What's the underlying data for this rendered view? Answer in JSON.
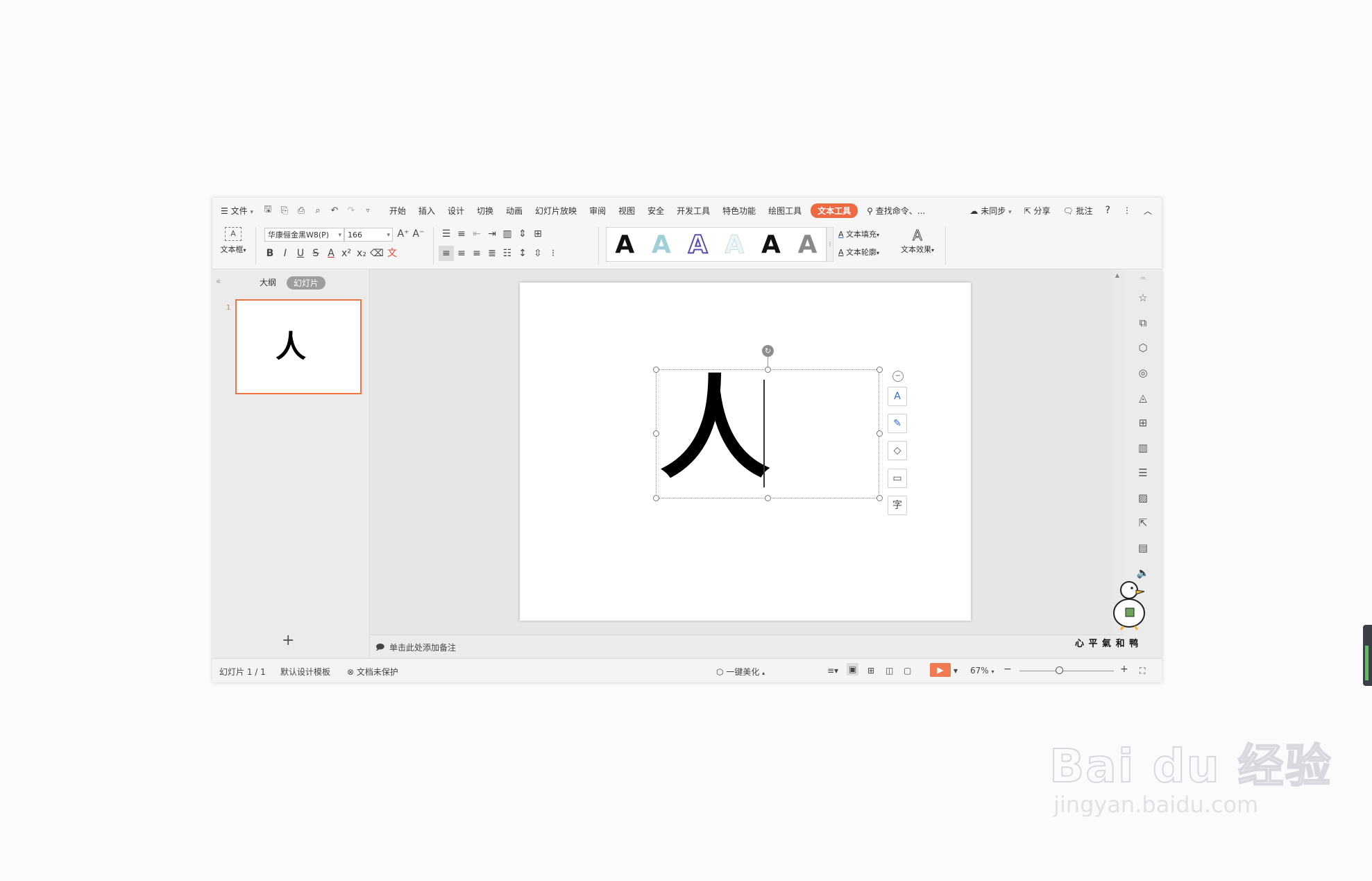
{
  "menubar": {
    "file": "文件",
    "tabs": [
      "开始",
      "插入",
      "设计",
      "切换",
      "动画",
      "幻灯片放映",
      "审阅",
      "视图",
      "安全",
      "开发工具",
      "特色功能",
      "绘图工具"
    ],
    "active_tab": "文本工具",
    "search": "查找命令、...",
    "sync": "未同步",
    "share": "分享",
    "comment": "批注",
    "help": "?"
  },
  "toolbar": {
    "textbox_label": "文本框",
    "font_name": "华康俪金黑W8(P)",
    "font_size": "166",
    "text_fill": "文本填充",
    "text_outline": "文本轮廓",
    "text_effect": "文本效果",
    "style_letter": "A",
    "style_colors": [
      "#111111",
      "#9fd0d8",
      "#5a4fb0",
      "#e4eff1",
      "#111111",
      "#8a8a8a"
    ]
  },
  "leftpanel": {
    "tab_outline": "大纲",
    "tab_slides": "幻灯片",
    "slide_number": "1",
    "thumb_text": "人",
    "add_label": "+"
  },
  "slide": {
    "text": "人"
  },
  "notes": {
    "placeholder": "单击此处添加备注"
  },
  "statusbar": {
    "slide_count": "幻灯片 1 / 1",
    "template": "默认设计模板",
    "protect": "文档未保护",
    "beautify": "一键美化",
    "zoom": "67%",
    "zoom_level": 0.42
  },
  "overlay": {
    "duck_caption": "心 平 氣 和 鸭"
  },
  "watermark": {
    "brand": "Bai du 经验",
    "url": "jingyan.baidu.com"
  },
  "colors": {
    "accent": "#ee6a43",
    "thumb_border": "#ee7542"
  }
}
